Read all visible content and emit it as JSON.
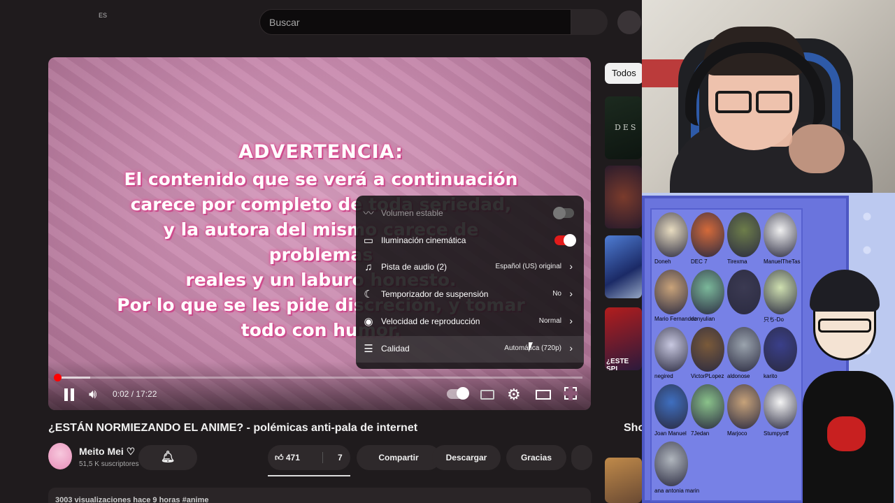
{
  "youtube": {
    "region_code": "ES",
    "search": {
      "placeholder": "Buscar"
    },
    "player": {
      "overlay_text": {
        "title": "ADVERTENCIA:",
        "lines": [
          "El contenido que se verá a continuación",
          "carece por completo de toda seriedad,",
          "y la autora del mismo carece de problemas",
          "reales y un laburo honesto.",
          "Por lo que se les pide discreción, y tomar",
          "todo con humor."
        ]
      },
      "time": "0:02 / 17:22",
      "progress": {
        "played_fraction": 0.0018,
        "loaded_fraction": 0.064
      },
      "settings_menu": [
        {
          "icon": "stable-volume-icon",
          "label": "Volumen estable",
          "value": "",
          "control": "switch-off",
          "dim": true
        },
        {
          "icon": "cinematic-lighting-icon",
          "label": "Iluminación cinemática",
          "value": "",
          "control": "switch-on",
          "dim": false
        },
        {
          "icon": "audio-track-icon",
          "label": "Pista de audio (2)",
          "value": "Español (US) original",
          "control": "chevron",
          "dim": false
        },
        {
          "icon": "sleep-timer-icon",
          "label": "Temporizador de suspensión",
          "value": "No",
          "control": "chevron",
          "dim": false
        },
        {
          "icon": "playback-speed-icon",
          "label": "Velocidad de reproducción",
          "value": "Normal",
          "control": "chevron",
          "dim": false
        },
        {
          "icon": "quality-icon",
          "label": "Calidad",
          "value": "Automática (720p)",
          "control": "chevron",
          "dim": false
        }
      ]
    },
    "video": {
      "title": "¿ESTÁN NORMIEZANDO EL ANIME? - polémicas anti-pala de internet",
      "channel": "Meito Mei ♡",
      "subscribers": "51,5 K suscriptores",
      "likes": "471",
      "dislikes": "7",
      "actions": {
        "share": "Compartir",
        "download": "Descargar",
        "thanks": "Gracias"
      },
      "description_preview": "3003 visualizaciones  hace 9 horas  #anime"
    },
    "sidebar": {
      "chip_all": "Todos",
      "thumb1_text": "DES",
      "thumb4_text": "¿ESTE SPI UTILIZA A",
      "shorts_label": "Sho"
    }
  },
  "overlay": {
    "subscribers": [
      {
        "name": "Doneh",
        "color": "#e8dcc0"
      },
      {
        "name": "DEC 7",
        "color": "#d46a3a"
      },
      {
        "name": "Tirexma",
        "color": "#6d7d4a"
      },
      {
        "name": "ManuelTheTas",
        "color": "#f0f0f0"
      },
      {
        "name": "Mario Fernandez",
        "color": "#c9a37a"
      },
      {
        "name": "donyulian",
        "color": "#7bb89a"
      },
      {
        "name": "",
        "color": "#3b3a52"
      },
      {
        "name": "只ち-Do",
        "color": "#cfe0b0"
      },
      {
        "name": "negired",
        "color": "#c8c8e0"
      },
      {
        "name": "VictorPLopez",
        "color": "#7a5a3a"
      },
      {
        "name": "aldonose",
        "color": "#9aa3ad"
      },
      {
        "name": "karito",
        "color": "#3a3f8a"
      },
      {
        "name": "Joan Manuel",
        "color": "#3f6fc0"
      },
      {
        "name": "7Jedan",
        "color": "#8ac28a"
      },
      {
        "name": "Marjoco",
        "color": "#c6a27a"
      },
      {
        "name": "Stumpyoff",
        "color": "#f4f4f4"
      },
      {
        "name": "ana antonia marin",
        "color": "#b0b6bd"
      }
    ]
  }
}
